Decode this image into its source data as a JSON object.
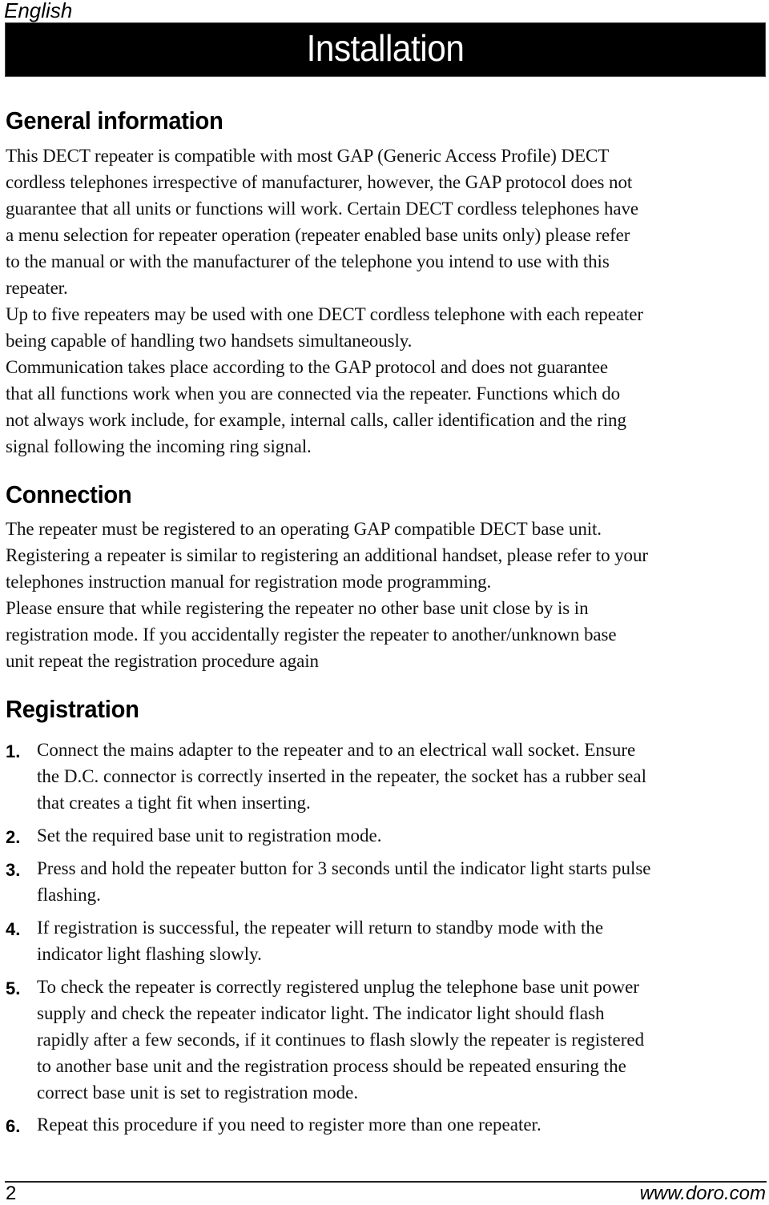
{
  "header": {
    "language": "English",
    "title": "Installation"
  },
  "sections": {
    "general": {
      "heading": "General information",
      "lines": [
        "This DECT repeater is compatible with most GAP (Generic Access Profile) DECT",
        "cordless telephones irrespective of manufacturer, however, the GAP protocol does not",
        "guarantee that all units or functions will work. Certain DECT cordless telephones have",
        "a menu selection for repeater operation (repeater enabled base units only) please refer",
        "to the manual or with the manufacturer of the telephone you intend to use with this",
        "repeater.",
        "Up to five repeaters may be used with one DECT cordless telephone with each repeater",
        "being capable of handling two handsets simultaneously.",
        "Communication takes place according to the GAP protocol and does not guarantee",
        "that all functions work when you are connected via the repeater. Functions which do",
        "not always work include, for example, internal calls, caller identification and the ring",
        "signal following the incoming ring signal."
      ]
    },
    "connection": {
      "heading": "Connection",
      "lines": [
        "The repeater must be registered to an operating GAP compatible DECT base unit.",
        "Registering a repeater is similar to registering an additional handset, please refer to your",
        "telephones instruction manual for registration mode programming.",
        "Please ensure that while registering the repeater no other base unit close by is in",
        "registration mode. If you accidentally register the repeater to another/unknown base",
        "unit repeat the registration procedure again"
      ]
    },
    "registration": {
      "heading": "Registration",
      "steps": [
        {
          "number": "1.",
          "lines": [
            "Connect the mains adapter to the repeater and to an electrical wall socket. Ensure",
            "the D.C. connector is correctly inserted in the repeater, the socket has a rubber seal",
            "that creates a tight fit when inserting."
          ]
        },
        {
          "number": "2.",
          "lines": [
            "Set the required base unit to registration mode."
          ]
        },
        {
          "number": "3.",
          "lines": [
            "Press and hold the repeater button for 3 seconds until the indicator light starts pulse",
            "flashing."
          ]
        },
        {
          "number": "4.",
          "lines": [
            "If registration is successful, the repeater will return to standby mode with the",
            "indicator light flashing slowly."
          ]
        },
        {
          "number": "5.",
          "lines": [
            "To check the repeater is correctly registered unplug the telephone base unit power",
            "supply and check the repeater indicator light. The indicator light should flash",
            "rapidly after a few seconds, if it continues to flash slowly the repeater is registered",
            "to another base unit and the registration process should be repeated ensuring the",
            "correct base unit is set to registration mode."
          ]
        },
        {
          "number": "6.",
          "lines": [
            "Repeat this procedure if you need to register more than one repeater."
          ]
        }
      ]
    }
  },
  "footer": {
    "page_number": "2",
    "url": "www.doro.com"
  }
}
